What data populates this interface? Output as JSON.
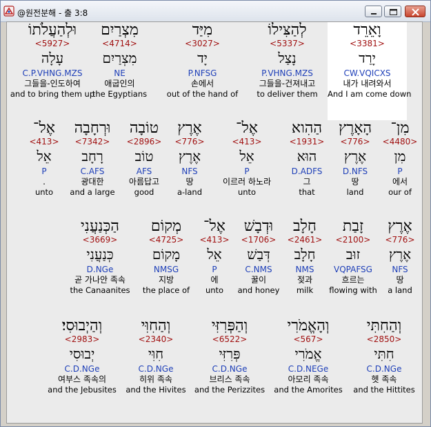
{
  "window": {
    "title": "@원전분해 - 출 3:8"
  },
  "rows": [
    [
      {
        "heb": "וָאֵרֵד",
        "strong": "<3381>",
        "lex": "יָרַד",
        "parse": "CW.VQICXS",
        "kor": "내가 내려와서",
        "eng": "And I am come down",
        "highlight": true
      },
      {
        "heb": "לְהַצִּילוֹ",
        "strong": "<5337>",
        "lex": "נָצַל",
        "parse": "P.VHNG.MZS",
        "kor": "그들을-건져내고",
        "eng": "to deliver them",
        "highlight": false
      },
      {
        "heb": "מִיַּד",
        "strong": "<3027>",
        "lex": "יָד",
        "parse": "P.NFSG",
        "kor": "손에서",
        "eng": "out of the hand of",
        "highlight": false
      },
      {
        "heb": "מִצְרַיִם",
        "strong": "<4714>",
        "lex": "מִצְרַיִם",
        "parse": "NE",
        "kor": "애굽인의",
        "eng": "the Egyptians",
        "highlight": false
      },
      {
        "heb": "וּלְהַעֲלֹתוֹ",
        "strong": "<5927>",
        "lex": "עָלָה",
        "parse": "C.P.VHNG.MZS",
        "kor": "그들을-인도하여",
        "eng": "and to bring them up",
        "highlight": false
      }
    ],
    [
      {
        "heb": "מִן־",
        "strong": "<4480>",
        "lex": "מִן",
        "parse": "P",
        "kor": "에서",
        "eng": "our of"
      },
      {
        "heb": "הָאָרֶץ",
        "strong": "<776>",
        "lex": "אֶרֶץ",
        "parse": "D.NFS",
        "kor": "땅",
        "eng": "land"
      },
      {
        "heb": "הַהִוא",
        "strong": "<1931>",
        "lex": "הוּא",
        "parse": "D.ADFS",
        "kor": "그",
        "eng": "that"
      },
      {
        "heb": "אֶל־",
        "strong": "<413>",
        "lex": "אֵל",
        "parse": "P",
        "kor": "이르러 하노라",
        "eng": "unto"
      },
      {
        "heb": "אֶרֶץ",
        "strong": "<776>",
        "lex": "אֶרֶץ",
        "parse": "NFS",
        "kor": "땅",
        "eng": "a-land"
      },
      {
        "heb": "טוֹבָה",
        "strong": "<2896>",
        "lex": "טוֹב",
        "parse": "AFS",
        "kor": "아름답고",
        "eng": "good"
      },
      {
        "heb": "וּרְחָבָה",
        "strong": "<7342>",
        "lex": "רָחָב",
        "parse": "C.AFS",
        "kor": "광대한",
        "eng": "and a large"
      },
      {
        "heb": "אֶל־",
        "strong": "<413>",
        "lex": "אֵל",
        "parse": "P",
        "kor": ".",
        "eng": "unto"
      }
    ],
    [
      {
        "heb": "אֶרֶץ",
        "strong": "<776>",
        "lex": "אֶרֶץ",
        "parse": "NFS",
        "kor": "땅",
        "eng": "a land"
      },
      {
        "heb": "זָבַת",
        "strong": "<2100>",
        "lex": "זוּב",
        "parse": "VQPAFSG",
        "kor": "흐르는",
        "eng": "flowing with"
      },
      {
        "heb": "חָלָב",
        "strong": "<2461>",
        "lex": "חָלָב",
        "parse": "NMS",
        "kor": "젖과",
        "eng": "milk"
      },
      {
        "heb": "וּדְבָשׁ",
        "strong": "<1706>",
        "lex": "דְּבַשׁ",
        "parse": "C.NMS",
        "kor": "꿀이",
        "eng": "and honey"
      },
      {
        "heb": "אֶל־",
        "strong": "<413>",
        "lex": "אֵל",
        "parse": "P",
        "kor": "에",
        "eng": "unto"
      },
      {
        "heb": "מְקוֹם",
        "strong": "<4725>",
        "lex": "מָקוֹם",
        "parse": "NMSG",
        "kor": "지방",
        "eng": "the place of"
      },
      {
        "heb": "הַכְּנַעֲנִי",
        "strong": "<3669>",
        "lex": "כְּנַעֲנִי",
        "parse": "D.NGe",
        "kor": "곧 가나안 족속",
        "eng": "the Canaanites"
      }
    ],
    [
      {
        "heb": "וְהַחִתִּי",
        "strong": "<2850>",
        "lex": "חִתִּי",
        "parse": "C.D.NGe",
        "kor": "헷 족속",
        "eng": "and the Hittites"
      },
      {
        "heb": "וְהָאֱמֹרִי",
        "strong": "<567>",
        "lex": "אֱמֹרִי",
        "parse": "C.D.NEGe",
        "kor": "아모리 족속",
        "eng": "and the Amorites"
      },
      {
        "heb": "וְהַפְּרִזִּי",
        "strong": "<6522>",
        "lex": "פְּרִזִּי",
        "parse": "C.D.NGe",
        "kor": "브리스 족속",
        "eng": "and the Perizzites"
      },
      {
        "heb": "וְהַחִוִּי",
        "strong": "<2340>",
        "lex": "חִוִּי",
        "parse": "C.D.NGe",
        "kor": "히위 족속",
        "eng": "and the Hivites"
      },
      {
        "heb": "וְהַיְבוּסִי׃",
        "strong": "<2983>",
        "lex": "יְבוּסִי",
        "parse": "C.D.NGe",
        "kor": "여부스 족속의",
        "eng": "and the Jebusites"
      }
    ]
  ]
}
